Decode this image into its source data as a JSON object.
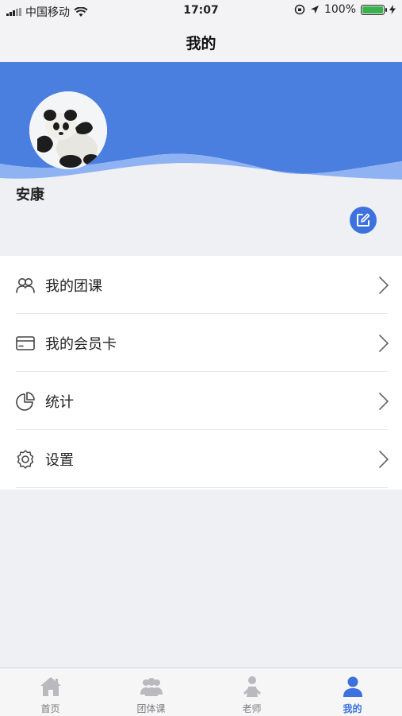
{
  "status_bar": {
    "carrier": "中国移动",
    "time": "17:07",
    "battery": "100%"
  },
  "nav": {
    "title": "我的"
  },
  "profile": {
    "username": "安康",
    "banner_color": "#4a7fe0"
  },
  "menu": {
    "items": [
      {
        "label": "我的团课",
        "icon": "group-class-icon"
      },
      {
        "label": "我的会员卡",
        "icon": "member-card-icon"
      },
      {
        "label": "统计",
        "icon": "pie-chart-icon"
      },
      {
        "label": "设置",
        "icon": "gear-icon"
      }
    ]
  },
  "tab_bar": {
    "items": [
      {
        "label": "首页",
        "icon": "home-icon"
      },
      {
        "label": "团体课",
        "icon": "group-icon"
      },
      {
        "label": "老师",
        "icon": "teacher-icon"
      },
      {
        "label": "我的",
        "icon": "person-icon",
        "active": true
      }
    ],
    "active_color": "#3d72de",
    "inactive_color": "#b9b9be"
  }
}
